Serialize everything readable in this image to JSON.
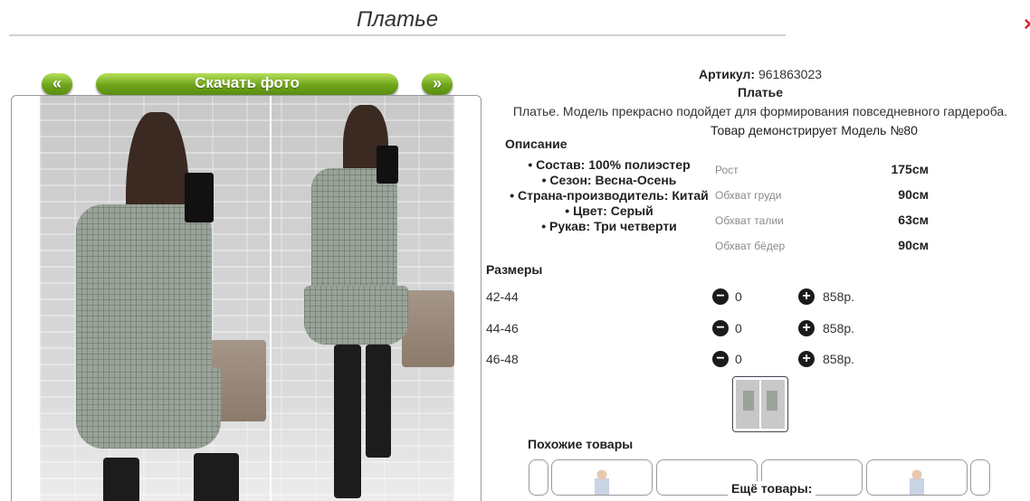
{
  "header": {
    "title": "Платье",
    "close_symbol": "×"
  },
  "gallery": {
    "prev_label": "«",
    "next_label": "»",
    "download_label": "Скачать фото"
  },
  "product": {
    "article_label": "Артикул:",
    "article_number": "961863023",
    "name": "Платье",
    "description": "Платье. Модель прекрасно подойдет для формирования повседневного гардероба.",
    "model_note": "Товар демонстрирует Модель №80"
  },
  "description_block": {
    "heading": "Описание",
    "items": [
      "Состав: 100% полиэстер",
      "Сезон: Весна-Осень",
      "Страна-производитель: Китай",
      "Цвет: Серый",
      "Рукав: Три четверти"
    ]
  },
  "model_params": [
    {
      "label": "Рост",
      "value": "175см"
    },
    {
      "label": "Обхват груди",
      "value": "90см"
    },
    {
      "label": "Обхват талии",
      "value": "63см"
    },
    {
      "label": "Обхват бёдер",
      "value": "90см"
    }
  ],
  "sizes": {
    "heading": "Размеры",
    "rows": [
      {
        "size": "42-44",
        "qty": "0",
        "price": "858р."
      },
      {
        "size": "44-46",
        "qty": "0",
        "price": "858р."
      },
      {
        "size": "46-48",
        "qty": "0",
        "price": "858р."
      }
    ],
    "minus_symbol": "−",
    "plus_symbol": "+"
  },
  "similar": {
    "heading": "Похожие товары",
    "more_label": "Ещё товары:"
  },
  "colors": {
    "accent_green": "#6ea41a",
    "close_red": "#d32222"
  }
}
